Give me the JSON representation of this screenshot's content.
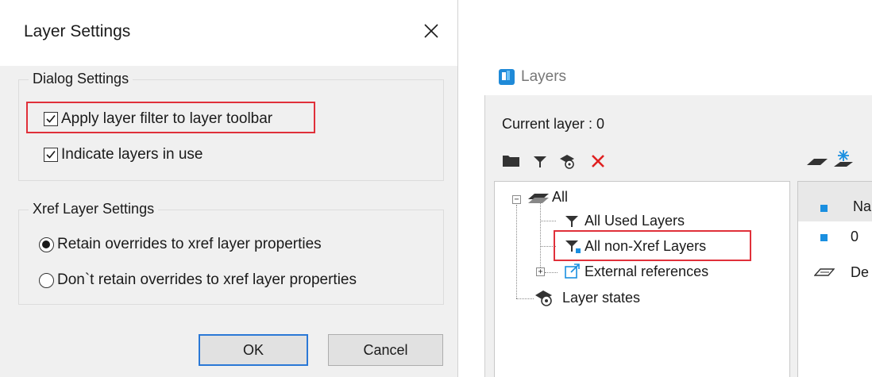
{
  "dialog": {
    "title": "Layer Settings",
    "dialog_settings": {
      "label": "Dialog Settings",
      "options": [
        {
          "label": "Apply layer filter to layer toolbar",
          "checked": true,
          "highlighted": true
        },
        {
          "label": "Indicate layers in use",
          "checked": true,
          "highlighted": false
        }
      ]
    },
    "xref_settings": {
      "label": "Xref Layer Settings",
      "options": [
        {
          "label": "Retain overrides to xref layer properties",
          "selected": true
        },
        {
          "label": "Don`t retain overrides to xref layer properties",
          "selected": false
        }
      ]
    },
    "ok_label": "OK",
    "cancel_label": "Cancel"
  },
  "layers_panel": {
    "title": "Layers",
    "current_layer": "Current layer : 0",
    "toolbar_icons": [
      "folder-icon",
      "filter-icon",
      "layer-states-icon",
      "delete-icon"
    ],
    "tree": {
      "root": {
        "label": "All",
        "expanded": true
      },
      "children": [
        {
          "label": "All Used Layers",
          "icon": "filter-icon"
        },
        {
          "label": "All non-Xref Layers",
          "icon": "filter-icon",
          "highlighted": true
        },
        {
          "label": "External references",
          "icon": "external-reference-icon",
          "expandable": true
        }
      ],
      "layer_states": "Layer states"
    },
    "list": {
      "header": "Na",
      "rows": [
        "0",
        "De"
      ]
    }
  },
  "colors": {
    "highlight_red": "#e0303a",
    "accent_blue": "#1a8fe0",
    "delete_red": "#e02020",
    "default_button_border": "#2a78d6"
  }
}
